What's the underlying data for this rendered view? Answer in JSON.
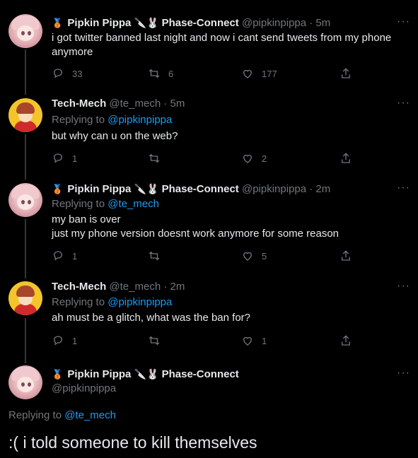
{
  "tweets": [
    {
      "name": "Pipkin Pippa",
      "badge": "🥉",
      "emojis": "🔪🐰",
      "group": "Phase-Connect",
      "handle": "@pipkinpippa",
      "time": "· 5m",
      "text": "i got twitter banned last night and now i cant send tweets from my phone anymore",
      "replies": "33",
      "retweets": "6",
      "likes": "177"
    },
    {
      "name": "Tech-Mech",
      "handle": "@te_mech",
      "time": "· 5m",
      "replying_label": "Replying to",
      "replying_to": "@pipkinpippa",
      "text": "but why can u on the web?",
      "replies": "1",
      "retweets": "",
      "likes": "2"
    },
    {
      "name": "Pipkin Pippa",
      "badge": "🥉",
      "emojis": "🔪🐰",
      "group": "Phase-Connect",
      "handle": "@pipkinpippa",
      "time": "· 2m",
      "replying_label": "Replying to",
      "replying_to": "@te_mech",
      "text_line1": "my ban is over",
      "text_line2": "just my phone version doesnt work anymore for some reason",
      "replies": "1",
      "retweets": "",
      "likes": "5"
    },
    {
      "name": "Tech-Mech",
      "handle": "@te_mech",
      "time": "· 2m",
      "replying_label": "Replying to",
      "replying_to": "@pipkinpippa",
      "text": "ah must be a glitch, what was the ban for?",
      "replies": "1",
      "retweets": "",
      "likes": "1"
    }
  ],
  "main": {
    "name": "Pipkin Pippa",
    "badge": "🥉",
    "emojis": "🔪🐰",
    "group": "Phase-Connect",
    "handle": "@pipkinpippa",
    "replying_label": "Replying to",
    "replying_to": "@te_mech",
    "text": ":( i told someone to kill themselves"
  },
  "more_glyph": "···"
}
